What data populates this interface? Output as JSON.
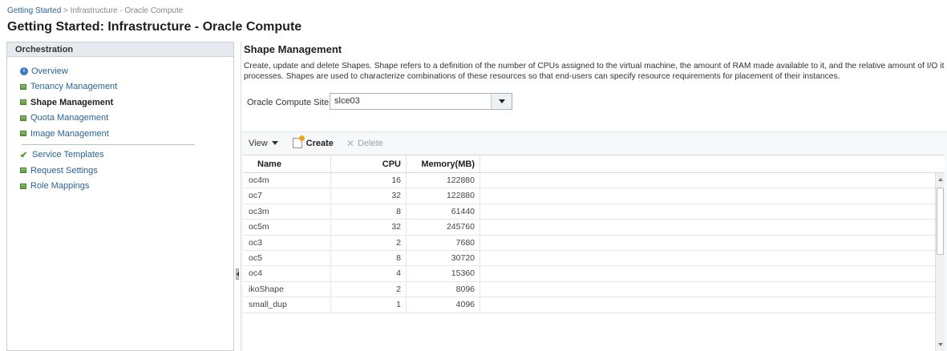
{
  "breadcrumb": {
    "link": "Getting Started",
    "separator": " > ",
    "current": "Infrastructure - Oracle Compute"
  },
  "page_title": "Getting Started: Infrastructure - Oracle Compute",
  "sidebar": {
    "header": "Orchestration",
    "items": [
      {
        "label": "Overview",
        "icon": "info-circle-icon"
      },
      {
        "label": "Tenancy Management",
        "icon": "green-square-icon"
      },
      {
        "label": "Shape Management",
        "icon": "green-square-icon",
        "active": true
      },
      {
        "label": "Quota Management",
        "icon": "green-square-icon"
      },
      {
        "label": "Image Management",
        "icon": "green-square-icon"
      },
      {
        "label": "Service Templates",
        "icon": "checkmark-icon"
      },
      {
        "label": "Request Settings",
        "icon": "green-square-icon"
      },
      {
        "label": "Role Mappings",
        "icon": "green-square-icon"
      }
    ]
  },
  "main": {
    "title": "Shape Management",
    "description": "Create, update and delete Shapes. Shape refers to a definition of the number of CPUs assigned to the virtual machine, the amount of RAM made available to it, and the relative amount of I/O it processes. Shapes are used to characterize combinations of these resources so that end-users can specify resource requirements for placement of their instances.",
    "site": {
      "label": "Oracle Compute Site",
      "value": "slce03"
    },
    "toolbar": {
      "view": "View",
      "create": "Create",
      "delete": "Delete"
    },
    "table": {
      "columns": [
        "Name",
        "CPU",
        "Memory(MB)"
      ],
      "rows": [
        [
          "oc4m",
          "16",
          "122880"
        ],
        [
          "oc7",
          "32",
          "122880"
        ],
        [
          "oc3m",
          "8",
          "61440"
        ],
        [
          "oc5m",
          "32",
          "245760"
        ],
        [
          "oc3",
          "2",
          "7680"
        ],
        [
          "oc5",
          "8",
          "30720"
        ],
        [
          "oc4",
          "4",
          "15360"
        ],
        [
          "ikoShape",
          "2",
          "8096"
        ],
        [
          "small_dup",
          "1",
          "4096"
        ]
      ]
    }
  },
  "colors": {
    "link": "#2a6496",
    "icon_green": "#5c9a3e",
    "header_bg": "#e6eaee"
  }
}
